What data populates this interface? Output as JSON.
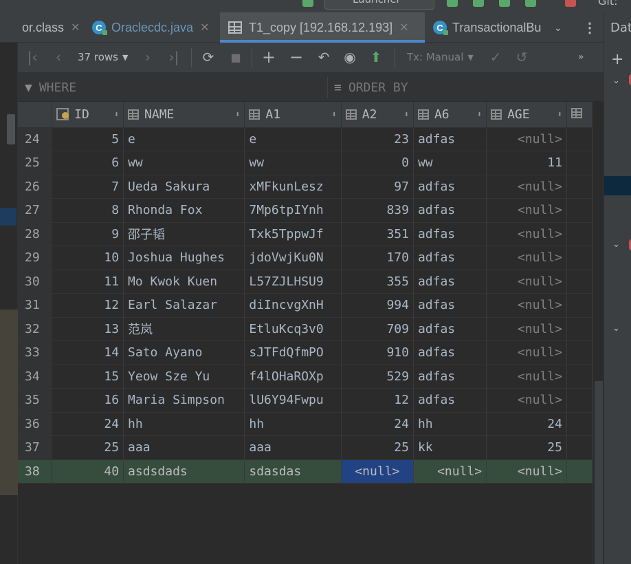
{
  "toolbar_top": {
    "launcher_label": "Launcher",
    "git_label": "Git:"
  },
  "tabs": [
    {
      "label": "or.class",
      "icon": "class-file-icon"
    },
    {
      "label": "Oraclecdc.java",
      "icon": "java-class-icon"
    },
    {
      "label": "T1_copy [192.168.12.193]",
      "icon": "table-icon",
      "active": true
    },
    {
      "label": "TransactionalBu",
      "icon": "java-class-icon"
    }
  ],
  "right_panel": {
    "title": "Dat"
  },
  "data_toolbar": {
    "rows_label": "37 rows",
    "tx_label": "Tx: Manual"
  },
  "filter": {
    "where_label": "WHERE",
    "order_label": "ORDER BY"
  },
  "grid": {
    "columns": [
      "ID",
      "NAME",
      "A1",
      "A2",
      "A6",
      "AGE"
    ],
    "rows": [
      {
        "n": "24",
        "id": "5",
        "name": "e",
        "a1": "e",
        "a2": "23",
        "a6": "adfas",
        "age": "<null>"
      },
      {
        "n": "25",
        "id": "6",
        "name": "ww",
        "a1": "ww",
        "a2": "0",
        "a6": "ww",
        "age": "11"
      },
      {
        "n": "26",
        "id": "7",
        "name": "Ueda Sakura",
        "a1": "xMFkunLesz",
        "a2": "97",
        "a6": "adfas",
        "age": "<null>"
      },
      {
        "n": "27",
        "id": "8",
        "name": "Rhonda Fox",
        "a1": "7Mp6tpIYnh",
        "a2": "839",
        "a6": "adfas",
        "age": "<null>"
      },
      {
        "n": "28",
        "id": "9",
        "name": "邵子韬",
        "a1": "Txk5TppwJf",
        "a2": "351",
        "a6": "adfas",
        "age": "<null>"
      },
      {
        "n": "29",
        "id": "10",
        "name": "Joshua Hughes",
        "a1": "jdoVwjKu0N",
        "a2": "170",
        "a6": "adfas",
        "age": "<null>"
      },
      {
        "n": "30",
        "id": "11",
        "name": "Mo Kwok Kuen",
        "a1": "L57ZJLHSU9",
        "a2": "355",
        "a6": "adfas",
        "age": "<null>"
      },
      {
        "n": "31",
        "id": "12",
        "name": "Earl Salazar",
        "a1": "diIncvgXnH",
        "a2": "994",
        "a6": "adfas",
        "age": "<null>"
      },
      {
        "n": "32",
        "id": "13",
        "name": "范岚",
        "a1": "EtluKcq3v0",
        "a2": "709",
        "a6": "adfas",
        "age": "<null>"
      },
      {
        "n": "33",
        "id": "14",
        "name": "Sato Ayano",
        "a1": "sJTFdQfmPO",
        "a2": "910",
        "a6": "adfas",
        "age": "<null>"
      },
      {
        "n": "34",
        "id": "15",
        "name": "Yeow Sze Yu",
        "a1": "f4lOHaROXp",
        "a2": "529",
        "a6": "adfas",
        "age": "<null>"
      },
      {
        "n": "35",
        "id": "16",
        "name": "Maria Simpson",
        "a1": "lU6Y94Fwpu",
        "a2": "12",
        "a6": "adfas",
        "age": "<null>"
      },
      {
        "n": "36",
        "id": "24",
        "name": "hh",
        "a1": "hh",
        "a2": "24",
        "a6": "hh",
        "age": "24"
      },
      {
        "n": "37",
        "id": "25",
        "name": "aaa",
        "a1": "aaa",
        "a2": "25",
        "a6": "kk",
        "age": "25"
      },
      {
        "n": "38",
        "id": "40",
        "name": "asdsdads",
        "a1": "sdasdas",
        "a2": "<null>",
        "a6": "<null>",
        "age": "<null>"
      }
    ]
  },
  "colors": {
    "accent": "#4a88c7",
    "selected_row": "#364d3e",
    "selected_cell": "#214283"
  }
}
